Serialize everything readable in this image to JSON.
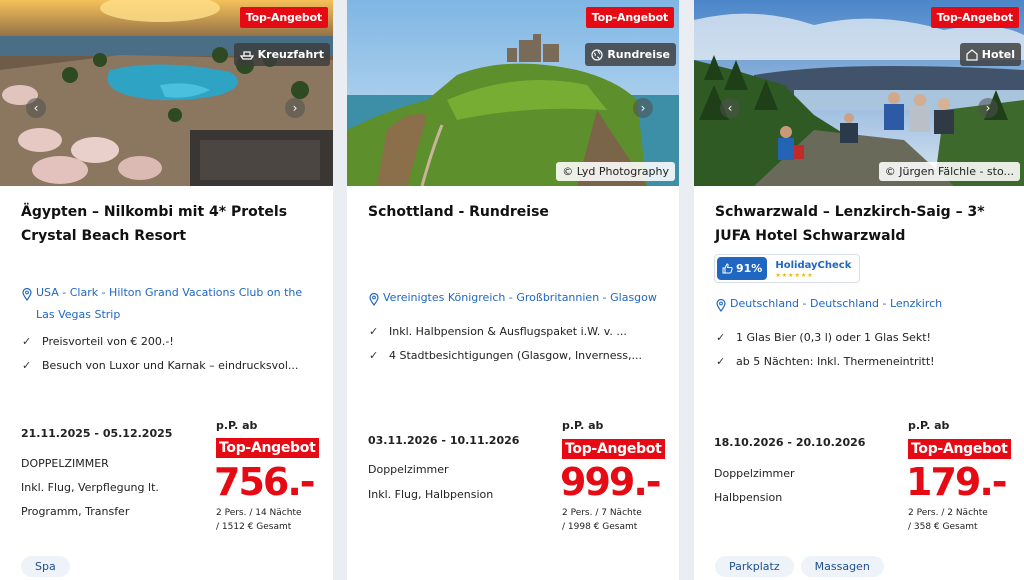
{
  "colors": {
    "accent_red": "#e60a14",
    "link_blue": "#1f67c1",
    "background": "#eaedf1"
  },
  "cards": [
    {
      "top_badge": "Top-Angebot",
      "type_badge": {
        "icon": "ship-icon",
        "label": "Kreuzfahrt"
      },
      "image_credit": "",
      "title": "Ägypten – Nilkombi mit 4* Protels Crystal Beach Resort",
      "location": "USA - Clark - Hilton Grand Vacations Club on the Las Vegas Strip",
      "features": [
        "Preisvorteil von € 200.-!",
        "Besuch von Luxor und Karnak – eindrucksvol..."
      ],
      "dates": "21.11.2025 - 05.12.2025",
      "room": "DOPPELZIMMER",
      "board_line1": "Inkl. Flug, Verpflegung lt.",
      "board_line2": "Programm, Transfer",
      "per_person_label": "p.P. ab",
      "price_badge": "Top-Angebot",
      "price": "756.-",
      "persons_line1": "2 Pers. / 14 Nächte",
      "persons_line2": "/ 1512 € Gesamt",
      "tags": [
        "Spa"
      ]
    },
    {
      "top_badge": "Top-Angebot",
      "type_badge": {
        "icon": "globe-icon",
        "label": "Rundreise"
      },
      "image_credit": "© Lyd Photography",
      "title": "Schottland - Rundreise",
      "location": "Vereinigtes Königreich - Großbritannien - Glasgow",
      "features": [
        "Inkl. Halbpension & Ausflugspaket i.W. v. ...",
        "4 Stadtbesichtigungen (Glasgow, Inverness,..."
      ],
      "dates": "03.11.2026 - 10.11.2026",
      "room": "Doppelzimmer",
      "board_line1": "Inkl. Flug, Halbpension",
      "per_person_label": "p.P. ab",
      "price_badge": "Top-Angebot",
      "price": "999.-",
      "persons_line1": "2 Pers. / 7 Nächte",
      "persons_line2": "/ 1998 € Gesamt",
      "tags": []
    },
    {
      "top_badge": "Top-Angebot",
      "type_badge": {
        "icon": "hotel-icon",
        "label": "Hotel"
      },
      "image_credit": "© Jürgen Fälchle - sto...",
      "title": "Schwarzwald – Lenzkirch-Saig – 3* JUFA Hotel Schwarzwald",
      "rating": {
        "score": "91%",
        "source": "HolidayCheck"
      },
      "location": "Deutschland - Deutschland - Lenzkirch",
      "features": [
        "1 Glas Bier (0,3 l) oder 1 Glas Sekt!",
        "ab 5 Nächten: Inkl. Thermeneintritt!"
      ],
      "dates": "18.10.2026 - 20.10.2026",
      "room": "Doppelzimmer",
      "board_line1": "Halbpension",
      "per_person_label": "p.P. ab",
      "price_badge": "Top-Angebot",
      "price": "179.-",
      "persons_line1": "2 Pers. / 2 Nächte",
      "persons_line2": "/ 358 € Gesamt",
      "tags": [
        "Parkplatz",
        "Massagen"
      ]
    }
  ]
}
